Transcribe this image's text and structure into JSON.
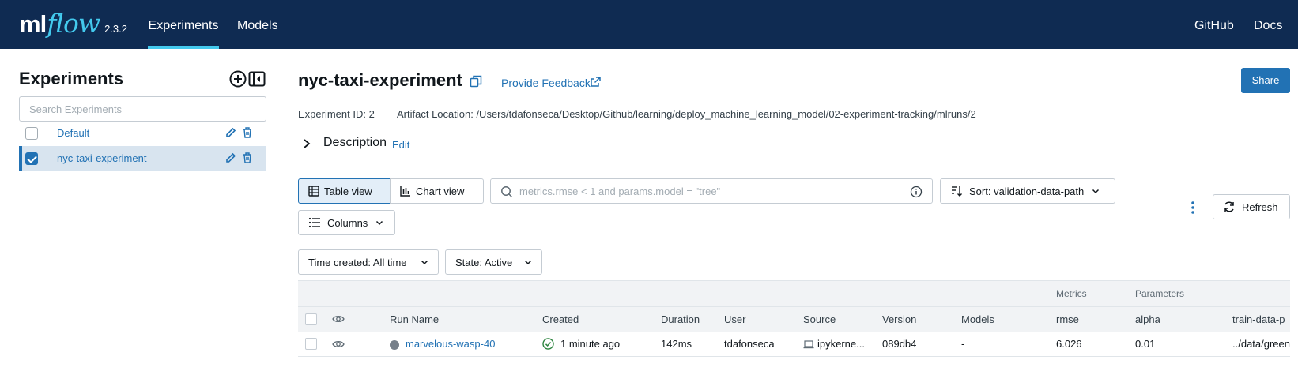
{
  "header": {
    "logo_ml": "ml",
    "logo_flow": "flow",
    "version": "2.3.2",
    "nav": [
      {
        "label": "Experiments",
        "active": true
      },
      {
        "label": "Models",
        "active": false
      }
    ],
    "right_links": [
      "GitHub",
      "Docs"
    ]
  },
  "sidebar": {
    "title": "Experiments",
    "search_placeholder": "Search Experiments",
    "experiments": [
      {
        "name": "Default",
        "checked": false
      },
      {
        "name": "nyc-taxi-experiment",
        "checked": true
      }
    ]
  },
  "main": {
    "title": "nyc-taxi-experiment",
    "feedback_label": "Provide Feedback",
    "share_label": "Share",
    "experiment_id": "Experiment ID: 2",
    "artifact_location": "Artifact Location: /Users/tdafonseca/Desktop/Github/learning/deploy_machine_learning_model/02-experiment-tracking/mlruns/2",
    "description_label": "Description",
    "description_edit": "Edit"
  },
  "toolbar": {
    "table_view": "Table view",
    "chart_view": "Chart view",
    "filter_placeholder": "metrics.rmse < 1 and params.model = \"tree\"",
    "sort_label": "Sort: validation-data-path",
    "columns_label": "Columns",
    "refresh_label": "Refresh",
    "time_created": "Time created: All time",
    "state": "State: Active"
  },
  "table": {
    "group_headers": {
      "metrics": "Metrics",
      "parameters": "Parameters"
    },
    "columns": [
      "Run Name",
      "Created",
      "Duration",
      "User",
      "Source",
      "Version",
      "Models",
      "rmse",
      "alpha",
      "train-data-p"
    ],
    "rows": [
      {
        "run_name": "marvelous-wasp-40",
        "created": "1 minute ago",
        "duration": "142ms",
        "user": "tdafonseca",
        "source": "ipykerne...",
        "version": "089db4",
        "models": "-",
        "rmse": "6.026",
        "alpha": "0.01",
        "train_data_path": "../data/green"
      }
    ]
  },
  "colors": {
    "header_bg": "#0f2b52",
    "accent": "#43c9ed",
    "primary": "#2272b4",
    "selected_bg": "#d8e4ef",
    "success": "#2e8540"
  }
}
